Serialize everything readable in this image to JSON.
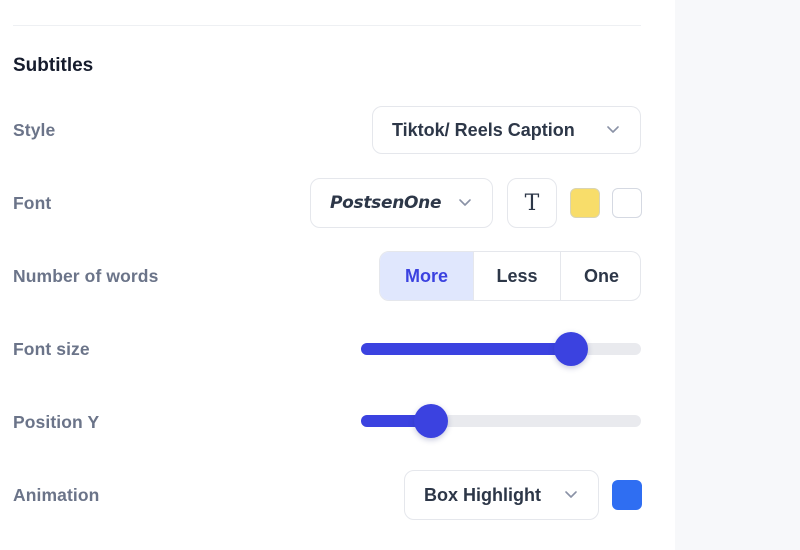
{
  "section": {
    "title": "Subtitles"
  },
  "rows": {
    "style": {
      "label": "Style",
      "select_value": "Tiktok/ Reels Caption"
    },
    "font": {
      "label": "Font",
      "select_value": "PostsenOne",
      "text_style_glyph": "T",
      "text_color": "#f8dd6a",
      "outline_color": "#ffffff"
    },
    "number_of_words": {
      "label": "Number of words",
      "options": [
        "More",
        "Less",
        "One"
      ],
      "selected": "More"
    },
    "font_size": {
      "label": "Font size",
      "value_fraction": 0.75
    },
    "position_y": {
      "label": "Position Y",
      "value_fraction": 0.25
    },
    "animation": {
      "label": "Animation",
      "select_value": "Box Highlight",
      "highlight_color": "#2f6ef2"
    }
  },
  "colors": {
    "accent": "#3b42e0",
    "accent_bg": "#e0e7fd",
    "label": "#6b7489",
    "heading": "#161c2d"
  }
}
